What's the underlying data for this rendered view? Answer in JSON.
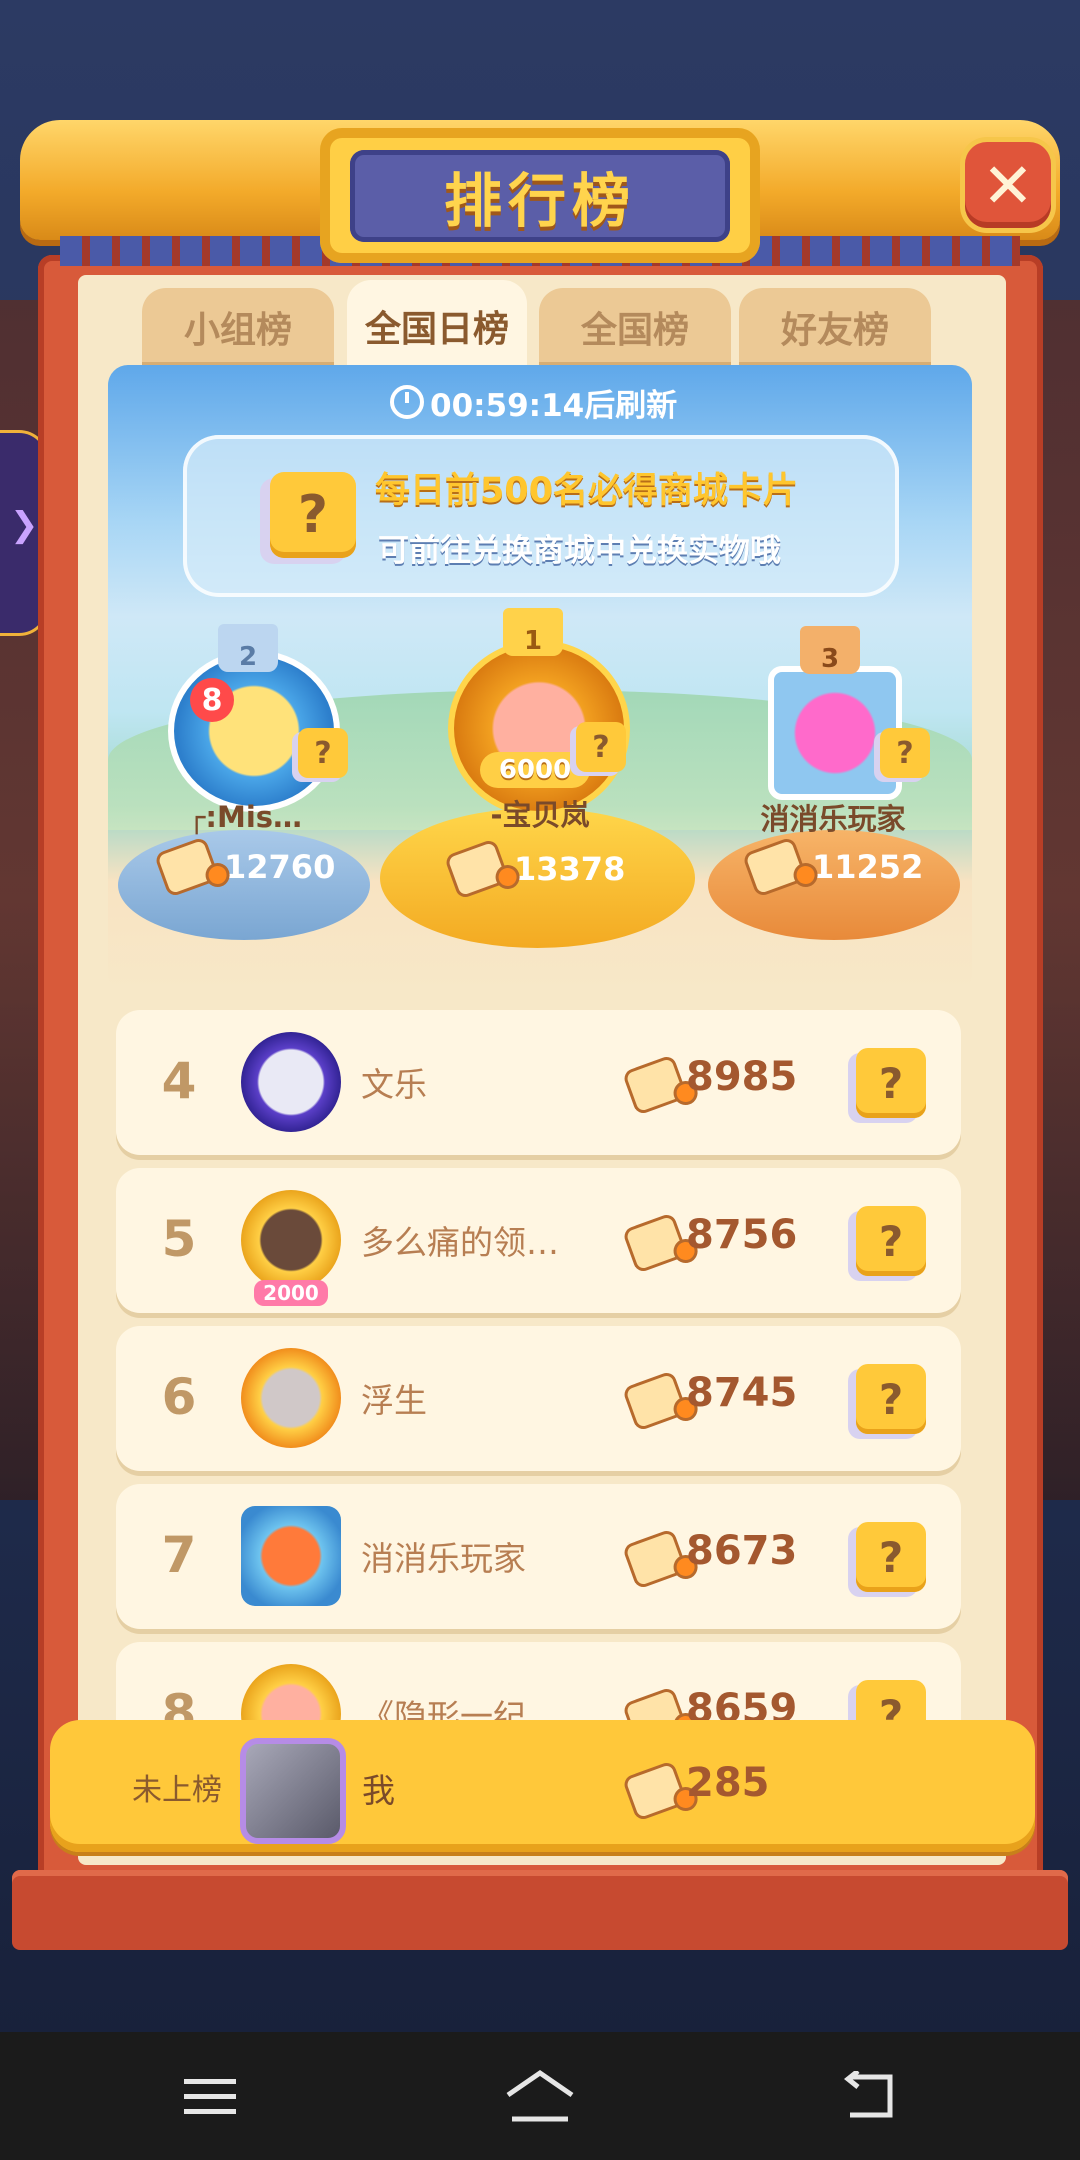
{
  "title": "排行榜",
  "close_symbol": "✕",
  "tabs": [
    "小组榜",
    "全国日榜",
    "全国榜",
    "好友榜"
  ],
  "active_tab": "全国日榜",
  "timer": "00:59:14后刷新",
  "banner": {
    "line1": "每日前500名必得商城卡片",
    "line2": "可前往兑换商城中兑换实物哦",
    "card_symbol": "?"
  },
  "top3": [
    {
      "rank": "2",
      "name": "┌:Mis…",
      "score": "12760",
      "badge": "8"
    },
    {
      "rank": "1",
      "name": "-宝贝岚",
      "score": "13378",
      "badge": "6000"
    },
    {
      "rank": "3",
      "name": "消消乐玩家",
      "score": "11252"
    }
  ],
  "rows": [
    {
      "rank": "4",
      "name": "文乐",
      "score": "8985"
    },
    {
      "rank": "5",
      "name": "多么痛的领…",
      "score": "8756",
      "badge": "2000"
    },
    {
      "rank": "6",
      "name": "浮生",
      "score": "8745"
    },
    {
      "rank": "7",
      "name": "消消乐玩家",
      "score": "8673"
    },
    {
      "rank": "8",
      "name": "《隐形一纪",
      "score": "8659"
    }
  ],
  "me": {
    "rank": "未上榜",
    "name": "我",
    "score": "285"
  },
  "colors": {
    "accent": "#ffc83a",
    "panel": "#d85a3a",
    "parchment": "#f7e8c8",
    "title_plate": "#5b5ea8"
  },
  "icons": {
    "close": "close-icon",
    "timer": "clock-icon",
    "score": "score-brush-icon",
    "card": "mystery-card-icon",
    "menu": "menu-icon",
    "home": "home-icon",
    "back": "back-icon"
  }
}
